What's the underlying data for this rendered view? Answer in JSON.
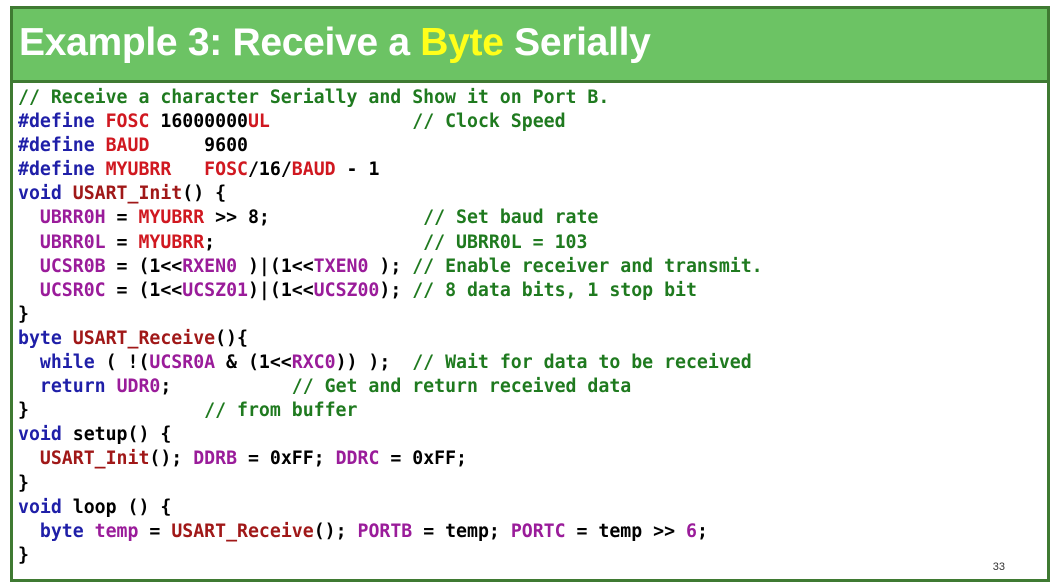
{
  "slide": {
    "title_parts": [
      "Example 3: Receive a ",
      "Byte",
      " Serially"
    ],
    "page_number": "33",
    "colors": {
      "header_bg": "#6cc364",
      "border": "#3f7a32",
      "title_text": "#ffffff",
      "title_highlight": "#ffff1a",
      "comment": "#1f7a1f",
      "keyword": "#1f1fa8",
      "macro": "#d01820",
      "register": "#9a1c9a",
      "function": "#a01818"
    }
  },
  "code_lines": [
    [
      [
        "cm",
        "// Receive a character Serially and Show it on Port B."
      ]
    ],
    [
      [
        "kw",
        "#define "
      ],
      [
        "mc",
        "FOSC"
      ],
      [
        "tx",
        " 16000000"
      ],
      [
        "mc",
        "UL"
      ],
      [
        "tx",
        "             "
      ],
      [
        "cm",
        "// Clock Speed"
      ]
    ],
    [
      [
        "kw",
        "#define "
      ],
      [
        "mc",
        "BAUD"
      ],
      [
        "tx",
        "     9600"
      ]
    ],
    [
      [
        "kw",
        "#define "
      ],
      [
        "mc",
        "MYUBRR"
      ],
      [
        "tx",
        "   "
      ],
      [
        "mc",
        "FOSC"
      ],
      [
        "tx",
        "/16/"
      ],
      [
        "mc",
        "BAUD"
      ],
      [
        "tx",
        " - 1"
      ]
    ],
    [
      [
        "kw",
        "void "
      ],
      [
        "fn",
        "USART_Init"
      ],
      [
        "tx",
        "() {"
      ]
    ],
    [
      [
        "tx",
        "  "
      ],
      [
        "rg",
        "UBRR0H"
      ],
      [
        "tx",
        " = "
      ],
      [
        "mc",
        "MYUBRR"
      ],
      [
        "tx",
        " >> 8;              "
      ],
      [
        "cm",
        "// Set baud rate"
      ]
    ],
    [
      [
        "tx",
        "  "
      ],
      [
        "rg",
        "UBRR0L"
      ],
      [
        "tx",
        " = "
      ],
      [
        "mc",
        "MYUBRR"
      ],
      [
        "tx",
        ";                   "
      ],
      [
        "cm",
        "// UBRR0L = 103"
      ]
    ],
    [
      [
        "tx",
        "  "
      ],
      [
        "rg",
        "UCSR0B"
      ],
      [
        "tx",
        " = (1<<"
      ],
      [
        "rg",
        "RXEN0"
      ],
      [
        "tx",
        " )|(1<<"
      ],
      [
        "rg",
        "TXEN0"
      ],
      [
        "tx",
        " ); "
      ],
      [
        "cm",
        "// Enable receiver and transmit."
      ]
    ],
    [
      [
        "tx",
        "  "
      ],
      [
        "rg",
        "UCSR0C"
      ],
      [
        "tx",
        " = (1<<"
      ],
      [
        "rg",
        "UCSZ01"
      ],
      [
        "tx",
        ")|(1<<"
      ],
      [
        "rg",
        "UCSZ00"
      ],
      [
        "tx",
        "); "
      ],
      [
        "cm",
        "// 8 data bits, 1 stop bit"
      ]
    ],
    [
      [
        "tx",
        "}"
      ]
    ],
    [
      [
        "kw",
        "byte "
      ],
      [
        "fn",
        "USART_Receive"
      ],
      [
        "tx",
        "(){"
      ]
    ],
    [
      [
        "tx",
        "  "
      ],
      [
        "kw",
        "while"
      ],
      [
        "tx",
        " ( !("
      ],
      [
        "rg",
        "UCSR0A"
      ],
      [
        "tx",
        " & (1<<"
      ],
      [
        "rg",
        "RXC0"
      ],
      [
        "tx",
        ")) );  "
      ],
      [
        "cm",
        "// Wait for data to be received"
      ]
    ],
    [
      [
        "tx",
        "  "
      ],
      [
        "kw",
        "return "
      ],
      [
        "rg",
        "UDR0"
      ],
      [
        "tx",
        ";           "
      ],
      [
        "cm",
        "// Get and return received data"
      ]
    ],
    [
      [
        "tx",
        "}                "
      ],
      [
        "cm",
        "// from buffer"
      ]
    ],
    [
      [
        "kw",
        "void "
      ],
      [
        "tx",
        "setup() {"
      ]
    ],
    [
      [
        "tx",
        "  "
      ],
      [
        "fn",
        "USART_Init"
      ],
      [
        "tx",
        "(); "
      ],
      [
        "rg",
        "DDRB"
      ],
      [
        "tx",
        " = 0xFF; "
      ],
      [
        "rg",
        "DDRC"
      ],
      [
        "tx",
        " = 0xFF;"
      ]
    ],
    [
      [
        "tx",
        "}"
      ]
    ],
    [
      [
        "kw",
        "void "
      ],
      [
        "tx",
        "loop () {"
      ]
    ],
    [
      [
        "tx",
        "  "
      ],
      [
        "kw",
        "byte "
      ],
      [
        "rg",
        "temp"
      ],
      [
        "tx",
        " = "
      ],
      [
        "fn",
        "USART_Receive"
      ],
      [
        "tx",
        "(); "
      ],
      [
        "rg",
        "PORTB"
      ],
      [
        "tx",
        " = temp; "
      ],
      [
        "rg",
        "PORTC"
      ],
      [
        "tx",
        " = temp >> "
      ],
      [
        "rg",
        "6"
      ],
      [
        "tx",
        ";"
      ]
    ],
    [
      [
        "tx",
        "}"
      ]
    ]
  ]
}
